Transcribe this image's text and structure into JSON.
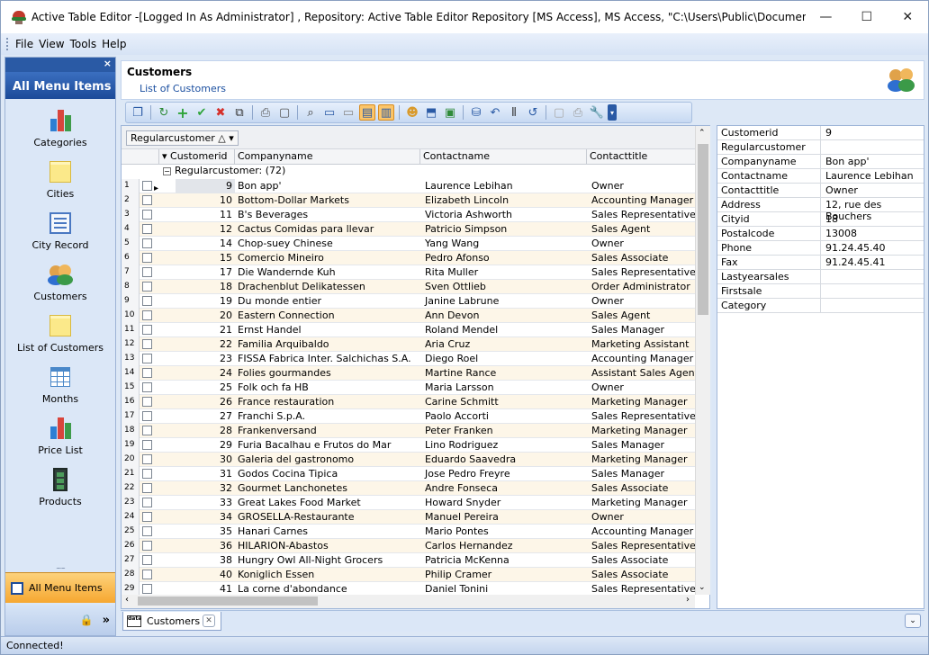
{
  "window": {
    "title": "Active Table Editor -[Logged In As Administrator] , Repository: Active Table Editor Repository  [MS Access], MS Access, \"C:\\Users\\Public\\Documents\\DBSL\\Active...",
    "min": "—",
    "max": "☐",
    "close": "✕"
  },
  "menu": [
    {
      "label": "File"
    },
    {
      "label": "View"
    },
    {
      "label": "Tools"
    },
    {
      "label": "Help"
    }
  ],
  "nav": {
    "close": "×",
    "title": "All Menu Items",
    "items": [
      {
        "label": "Categories",
        "icon": "bar-chart-icon"
      },
      {
        "label": "Cities",
        "icon": "note-icon"
      },
      {
        "label": "City Record",
        "icon": "form-icon"
      },
      {
        "label": "Customers",
        "icon": "people-icon"
      },
      {
        "label": "List of Customers",
        "icon": "note-icon"
      },
      {
        "label": "Months",
        "icon": "calendar-grid-icon"
      },
      {
        "label": "Price List",
        "icon": "bar-chart-icon"
      },
      {
        "label": "Products",
        "icon": "film-icon"
      }
    ],
    "grip": "........",
    "all_menu": "All Menu Items",
    "lock": "🔒",
    "expand": "»"
  },
  "header": {
    "title": "Customers",
    "subtitle": "List of Customers"
  },
  "grid": {
    "group_chip": "Regularcustomer  △  ▾",
    "columns": {
      "id": "Customerid",
      "company": "Companyname",
      "contact": "Contactname",
      "title": "Contacttitle"
    },
    "group_label": "Regularcustomer:  (72)",
    "rows": [
      {
        "n": "1",
        "id": "9",
        "company": "Bon app'",
        "contact": "Laurence Lebihan",
        "title": "Owner"
      },
      {
        "n": "2",
        "id": "10",
        "company": "Bottom-Dollar Markets",
        "contact": "Elizabeth Lincoln",
        "title": "Accounting Manager"
      },
      {
        "n": "3",
        "id": "11",
        "company": "B's Beverages",
        "contact": "Victoria Ashworth",
        "title": "Sales Representative"
      },
      {
        "n": "4",
        "id": "12",
        "company": "Cactus Comidas para llevar",
        "contact": "Patricio Simpson",
        "title": "Sales Agent"
      },
      {
        "n": "5",
        "id": "14",
        "company": "Chop-suey Chinese",
        "contact": "Yang Wang",
        "title": "Owner"
      },
      {
        "n": "6",
        "id": "15",
        "company": "Comercio Mineiro",
        "contact": "Pedro Afonso",
        "title": "Sales Associate"
      },
      {
        "n": "7",
        "id": "17",
        "company": "Die Wandernde Kuh",
        "contact": "Rita Muller",
        "title": "Sales Representative"
      },
      {
        "n": "8",
        "id": "18",
        "company": "Drachenblut Delikatessen",
        "contact": "Sven Ottlieb",
        "title": "Order Administrator"
      },
      {
        "n": "9",
        "id": "19",
        "company": "Du monde entier",
        "contact": "Janine Labrune",
        "title": "Owner"
      },
      {
        "n": "10",
        "id": "20",
        "company": "Eastern Connection",
        "contact": "Ann Devon",
        "title": "Sales Agent"
      },
      {
        "n": "11",
        "id": "21",
        "company": "Ernst Handel",
        "contact": "Roland Mendel",
        "title": "Sales Manager"
      },
      {
        "n": "12",
        "id": "22",
        "company": "Familia Arquibaldo",
        "contact": "Aria Cruz",
        "title": "Marketing Assistant"
      },
      {
        "n": "13",
        "id": "23",
        "company": "FISSA Fabrica Inter. Salchichas S.A.",
        "contact": "Diego Roel",
        "title": "Accounting Manager"
      },
      {
        "n": "14",
        "id": "24",
        "company": "Folies gourmandes",
        "contact": "Martine Rance",
        "title": "Assistant Sales Agent"
      },
      {
        "n": "15",
        "id": "25",
        "company": "Folk och fa HB",
        "contact": "Maria Larsson",
        "title": "Owner"
      },
      {
        "n": "16",
        "id": "26",
        "company": "France restauration",
        "contact": "Carine Schmitt",
        "title": "Marketing Manager"
      },
      {
        "n": "17",
        "id": "27",
        "company": "Franchi S.p.A.",
        "contact": "Paolo Accorti",
        "title": "Sales Representative"
      },
      {
        "n": "18",
        "id": "28",
        "company": "Frankenversand",
        "contact": "Peter Franken",
        "title": "Marketing Manager"
      },
      {
        "n": "19",
        "id": "29",
        "company": "Furia Bacalhau e Frutos do Mar",
        "contact": "Lino Rodriguez",
        "title": "Sales Manager"
      },
      {
        "n": "20",
        "id": "30",
        "company": "Galeria del gastronomo",
        "contact": "Eduardo Saavedra",
        "title": "Marketing Manager"
      },
      {
        "n": "21",
        "id": "31",
        "company": "Godos Cocina Tipica",
        "contact": "Jose Pedro Freyre",
        "title": "Sales Manager"
      },
      {
        "n": "22",
        "id": "32",
        "company": "Gourmet Lanchonetes",
        "contact": "Andre Fonseca",
        "title": "Sales Associate"
      },
      {
        "n": "23",
        "id": "33",
        "company": "Great Lakes Food Market",
        "contact": "Howard Snyder",
        "title": "Marketing Manager"
      },
      {
        "n": "24",
        "id": "34",
        "company": "GROSELLA-Restaurante",
        "contact": "Manuel Pereira",
        "title": "Owner"
      },
      {
        "n": "25",
        "id": "35",
        "company": "Hanari Carnes",
        "contact": "Mario Pontes",
        "title": "Accounting Manager"
      },
      {
        "n": "26",
        "id": "36",
        "company": "HILARION-Abastos",
        "contact": "Carlos Hernandez",
        "title": "Sales Representative"
      },
      {
        "n": "27",
        "id": "38",
        "company": "Hungry Owl All-Night Grocers",
        "contact": "Patricia McKenna",
        "title": "Sales Associate"
      },
      {
        "n": "28",
        "id": "40",
        "company": "Koniglich Essen",
        "contact": "Philip Cramer",
        "title": "Sales Associate"
      },
      {
        "n": "29",
        "id": "41",
        "company": "La corne d'abondance",
        "contact": "Daniel Tonini",
        "title": "Sales Representative"
      }
    ]
  },
  "properties": [
    {
      "name": "Customerid",
      "value": "9"
    },
    {
      "name": "Regularcustomer",
      "value": ""
    },
    {
      "name": "Companyname",
      "value": "Bon app'"
    },
    {
      "name": "Contactname",
      "value": "Laurence Lebihan"
    },
    {
      "name": "Contacttitle",
      "value": "Owner"
    },
    {
      "name": "Address",
      "value": "12, rue des Bouchers"
    },
    {
      "name": "Cityid",
      "value": "18"
    },
    {
      "name": "Postalcode",
      "value": "13008"
    },
    {
      "name": "Phone",
      "value": "91.24.45.40"
    },
    {
      "name": "Fax",
      "value": "91.24.45.41"
    },
    {
      "name": "Lastyearsales",
      "value": ""
    },
    {
      "name": "Firstsale",
      "value": ""
    },
    {
      "name": "Category",
      "value": ""
    }
  ],
  "tab": {
    "label": "Customers",
    "icon_text": "data"
  },
  "status": {
    "text": "Connected!"
  },
  "colors": {
    "accent": "#2a5aa5",
    "row_alt": "#fdf6e8",
    "selected_toolbar": "#fbc56a"
  }
}
